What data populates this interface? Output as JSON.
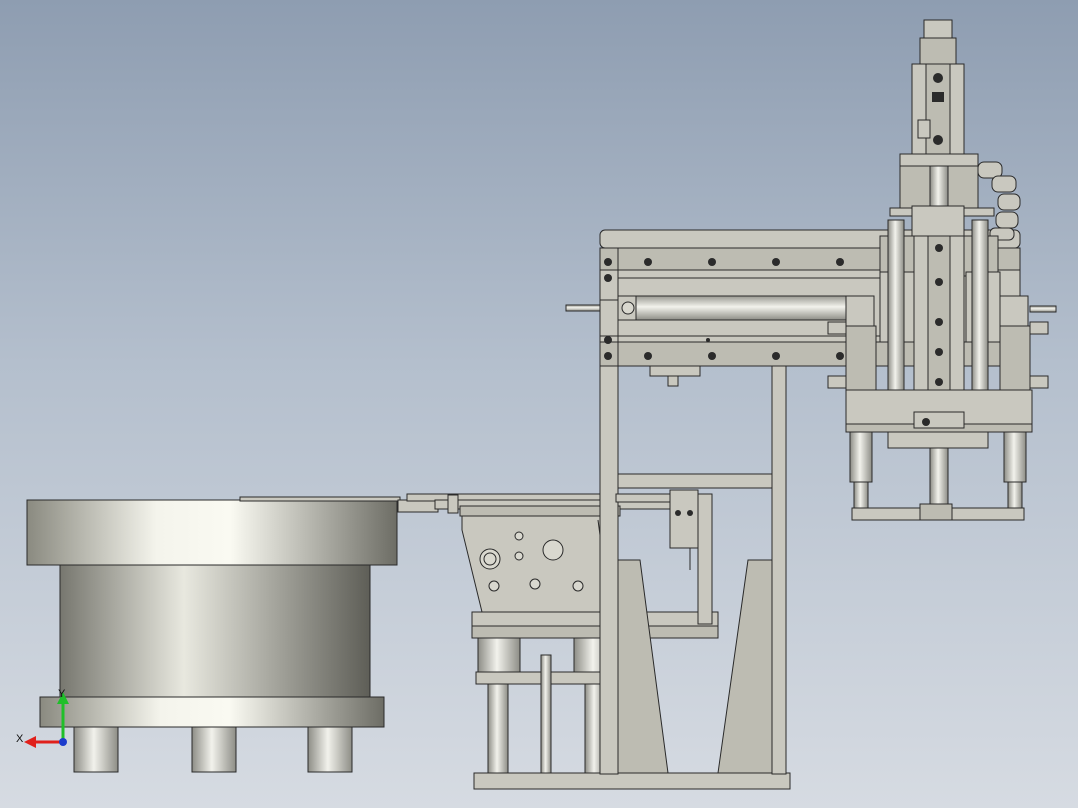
{
  "view": {
    "background_top": "#8e9db1",
    "background_bottom": "#d6dbe2",
    "part_color": "#c9c8bf",
    "edge_color": "#2a2a2a"
  },
  "triad": {
    "x_label": "X",
    "y_label": "Y",
    "x_color": "#e0201b",
    "y_color": "#1fbf2a",
    "z_color": "#1c3ccc"
  }
}
